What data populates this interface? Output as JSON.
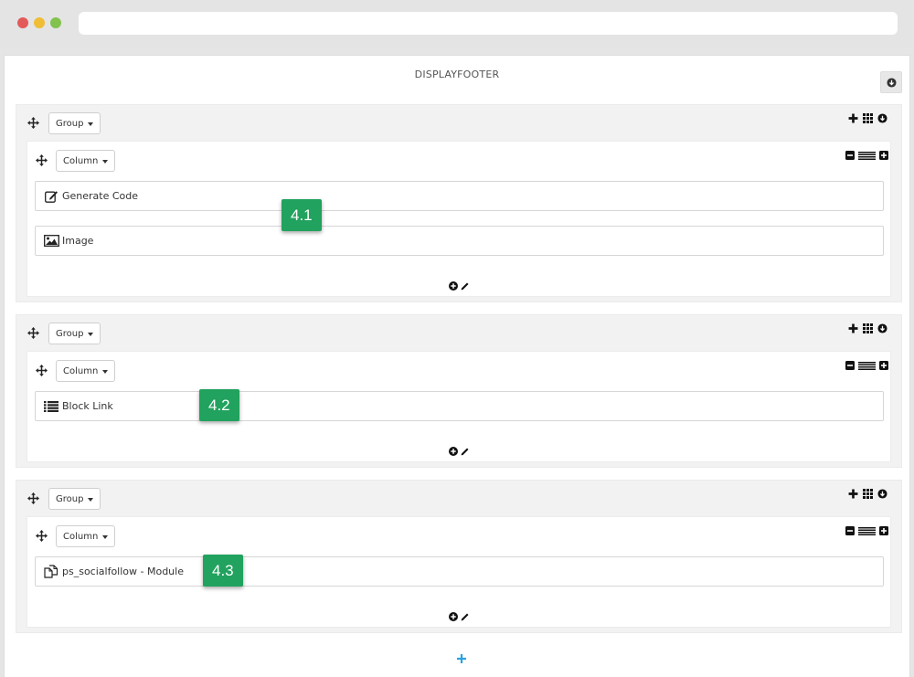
{
  "hook": {
    "title": "DISPLAYFOOTER"
  },
  "groups": [
    {
      "label": "Group",
      "column": {
        "label": "Column",
        "widgets": [
          {
            "label": "Generate Code",
            "icon": "edit-icon"
          },
          {
            "label": "Image",
            "icon": "image-icon"
          }
        ]
      },
      "badge": "4.1"
    },
    {
      "label": "Group",
      "column": {
        "label": "Column",
        "widgets": [
          {
            "label": "Block Link",
            "icon": "list-icon"
          }
        ]
      },
      "badge": "4.2"
    },
    {
      "label": "Group",
      "column": {
        "label": "Column",
        "widgets": [
          {
            "label": "ps_socialfollow - Module",
            "icon": "copy-icon"
          }
        ]
      },
      "badge": "4.3"
    }
  ],
  "colors": {
    "badge": "#21a25e",
    "add_accent": "#29a3e0",
    "group_bg": "#f2f2f2"
  }
}
